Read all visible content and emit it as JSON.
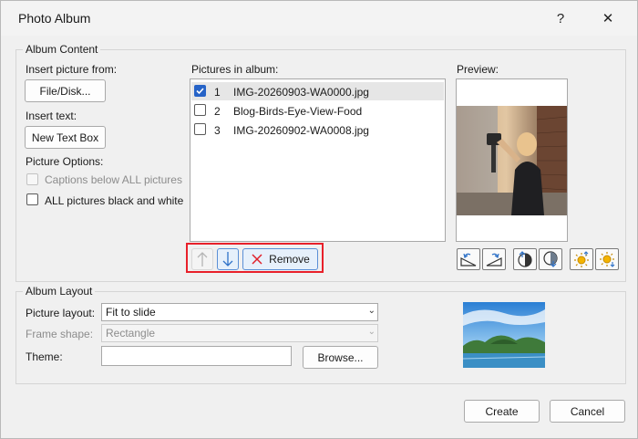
{
  "window": {
    "title": "Photo Album",
    "help_glyph": "?",
    "close_glyph": "✕"
  },
  "album_content": {
    "legend": "Album Content",
    "insert_picture_label": "Insert picture from:",
    "file_disk_button": "File/Disk...",
    "insert_text_label": "Insert text:",
    "new_text_box_button": "New Text Box",
    "picture_options_label": "Picture Options:",
    "captions_option": "Captions below ALL pictures",
    "captions_checked": false,
    "black_white_option": "ALL pictures black and white",
    "black_white_checked": false,
    "pictures_label": "Pictures in album:",
    "pictures": [
      {
        "num": "1",
        "name": "IMG-20260903-WA0000.jpg",
        "checked": true
      },
      {
        "num": "2",
        "name": "Blog-Birds-Eye-View-Food",
        "checked": false
      },
      {
        "num": "3",
        "name": "IMG-20260902-WA0008.jpg",
        "checked": false
      }
    ],
    "remove_button": "Remove",
    "preview_label": "Preview:",
    "highlight_color": "#e8202a"
  },
  "album_layout": {
    "legend": "Album Layout",
    "picture_layout_label": "Picture layout:",
    "picture_layout_value": "Fit to slide",
    "frame_shape_label": "Frame shape:",
    "frame_shape_value": "Rectangle",
    "theme_label": "Theme:",
    "theme_value": "",
    "browse_button": "Browse..."
  },
  "footer": {
    "create_button": "Create",
    "cancel_button": "Cancel"
  }
}
